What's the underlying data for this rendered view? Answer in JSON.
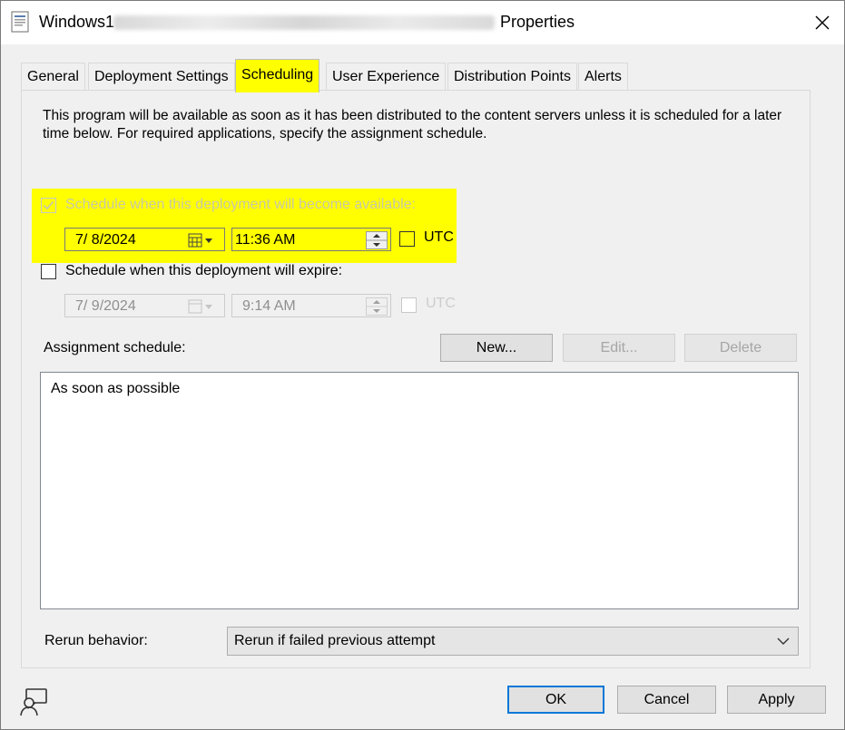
{
  "window": {
    "title_prefix": "Windows1",
    "title_suffix": "Properties",
    "close_label": "✕"
  },
  "tabs": [
    {
      "label": "General",
      "active": false
    },
    {
      "label": "Deployment Settings",
      "active": false
    },
    {
      "label": "Scheduling",
      "active": true
    },
    {
      "label": "User Experience",
      "active": false
    },
    {
      "label": "Distribution Points",
      "active": false
    },
    {
      "label": "Alerts",
      "active": false
    }
  ],
  "scheduling": {
    "intro": "This program will be available as soon as it has been distributed to the content servers unless it is scheduled for a later time below. For required applications, specify the assignment schedule.",
    "available": {
      "checkbox_label": "Schedule when this deployment will become available:",
      "checked": true,
      "enabled": false,
      "date": "7/  8/2024",
      "time": "11:36 AM",
      "utc_label": "UTC",
      "utc_checked": false
    },
    "expire": {
      "checkbox_label": "Schedule when this deployment will expire:",
      "checked": false,
      "date": "7/  9/2024",
      "time": "9:14 AM",
      "utc_label": "UTC",
      "utc_checked": false
    },
    "assignment": {
      "label": "Assignment schedule:",
      "new_label": "New...",
      "edit_label": "Edit...",
      "delete_label": "Delete",
      "items": [
        "As soon as possible"
      ]
    },
    "rerun": {
      "label": "Rerun behavior:",
      "value": "Rerun if failed previous attempt"
    }
  },
  "footer": {
    "ok_label": "OK",
    "cancel_label": "Cancel",
    "apply_label": "Apply"
  },
  "colors": {
    "highlight": "#ffff00",
    "default_button_border": "#0078d7"
  }
}
